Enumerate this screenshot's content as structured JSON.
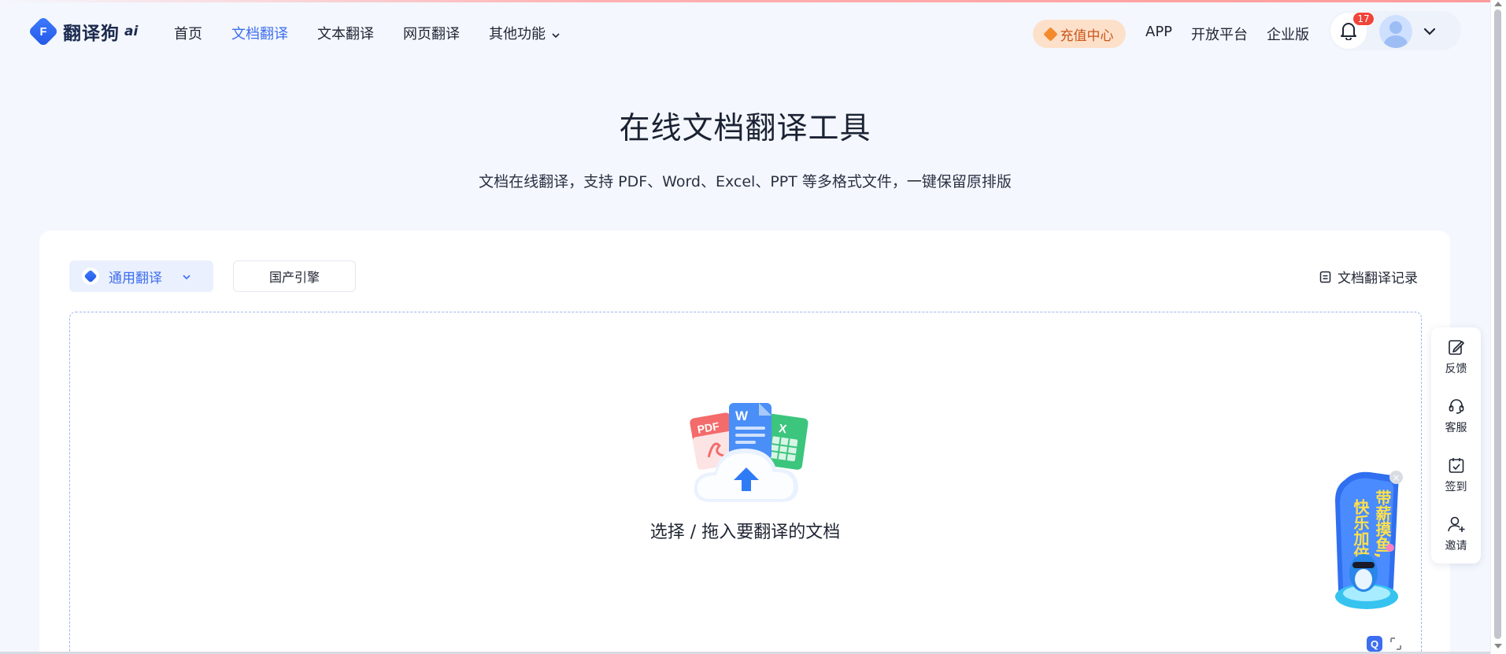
{
  "brand": {
    "logo_letter": "F",
    "name": "翻译狗",
    "ai_mark": "ai",
    "accent_color": "#3d6df0"
  },
  "nav": {
    "items": [
      {
        "label": "首页",
        "active": false
      },
      {
        "label": "文档翻译",
        "active": true
      },
      {
        "label": "文本翻译",
        "active": false
      },
      {
        "label": "网页翻译",
        "active": false
      },
      {
        "label": "其他功能",
        "active": false
      }
    ]
  },
  "header": {
    "recharge_label": "充值中心",
    "links": [
      "APP",
      "开放平台",
      "企业版"
    ],
    "notification_count": "17"
  },
  "hero": {
    "title": "在线文档翻译工具",
    "subtitle": "文档在线翻译，支持 PDF、Word、Excel、PPT 等多格式文件，一键保留原排版"
  },
  "toolbar": {
    "engine_label": "通用翻译",
    "domestic_engine_label": "国产引擎",
    "record_label": "文档翻译记录"
  },
  "upload": {
    "label": "选择 / 拖入要翻译的文档",
    "file_badges": [
      "PDF",
      "W",
      "X"
    ]
  },
  "side_tools": [
    {
      "label": "反馈",
      "icon": "feedback-icon"
    },
    {
      "label": "客服",
      "icon": "headset-icon"
    },
    {
      "label": "签到",
      "icon": "calendar-check-icon"
    },
    {
      "label": "邀请",
      "icon": "user-add-icon"
    }
  ],
  "promo": {
    "text_line1": "带薪摸鱼,",
    "text_line2": "快乐加倍"
  },
  "mini": {
    "q_label": "Q"
  }
}
